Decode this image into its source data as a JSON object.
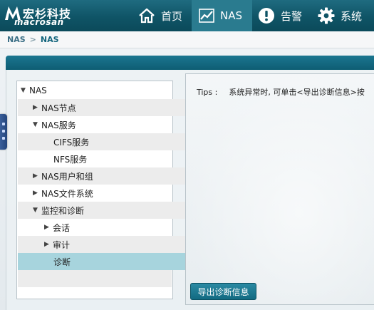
{
  "header": {
    "logo_cn": "宏杉科技",
    "logo_en": "macrosan",
    "nav": [
      {
        "label": "首页",
        "icon": "home-icon"
      },
      {
        "label": "NAS",
        "icon": "chart-icon"
      },
      {
        "label": "告警",
        "icon": "alert-icon"
      },
      {
        "label": "系统",
        "icon": "gear-icon"
      }
    ]
  },
  "breadcrumb": {
    "root": "NAS",
    "separator": ">",
    "current": "NAS"
  },
  "tree": {
    "items": [
      {
        "label": "NAS",
        "expanded": true
      },
      {
        "label": "NAS节点",
        "expanded": false
      },
      {
        "label": "NAS服务",
        "expanded": true
      },
      {
        "label": "CIFS服务"
      },
      {
        "label": "NFS服务"
      },
      {
        "label": "NAS用户和组",
        "expanded": false
      },
      {
        "label": "NAS文件系统",
        "expanded": false
      },
      {
        "label": "监控和诊断",
        "expanded": true
      },
      {
        "label": "会话",
        "expanded": false
      },
      {
        "label": "审计",
        "expanded": false
      },
      {
        "label": "诊断",
        "selected": true
      }
    ]
  },
  "tips": {
    "label": "Tips :",
    "text": "系统异常时, 可单击<导出诊断信息>按"
  },
  "buttons": {
    "export": "导出诊断信息"
  },
  "colors": {
    "header": "#0f5466",
    "active_nav": "#2a7b8f",
    "selected_row": "#a7d4dd",
    "button": "#1a7891"
  }
}
